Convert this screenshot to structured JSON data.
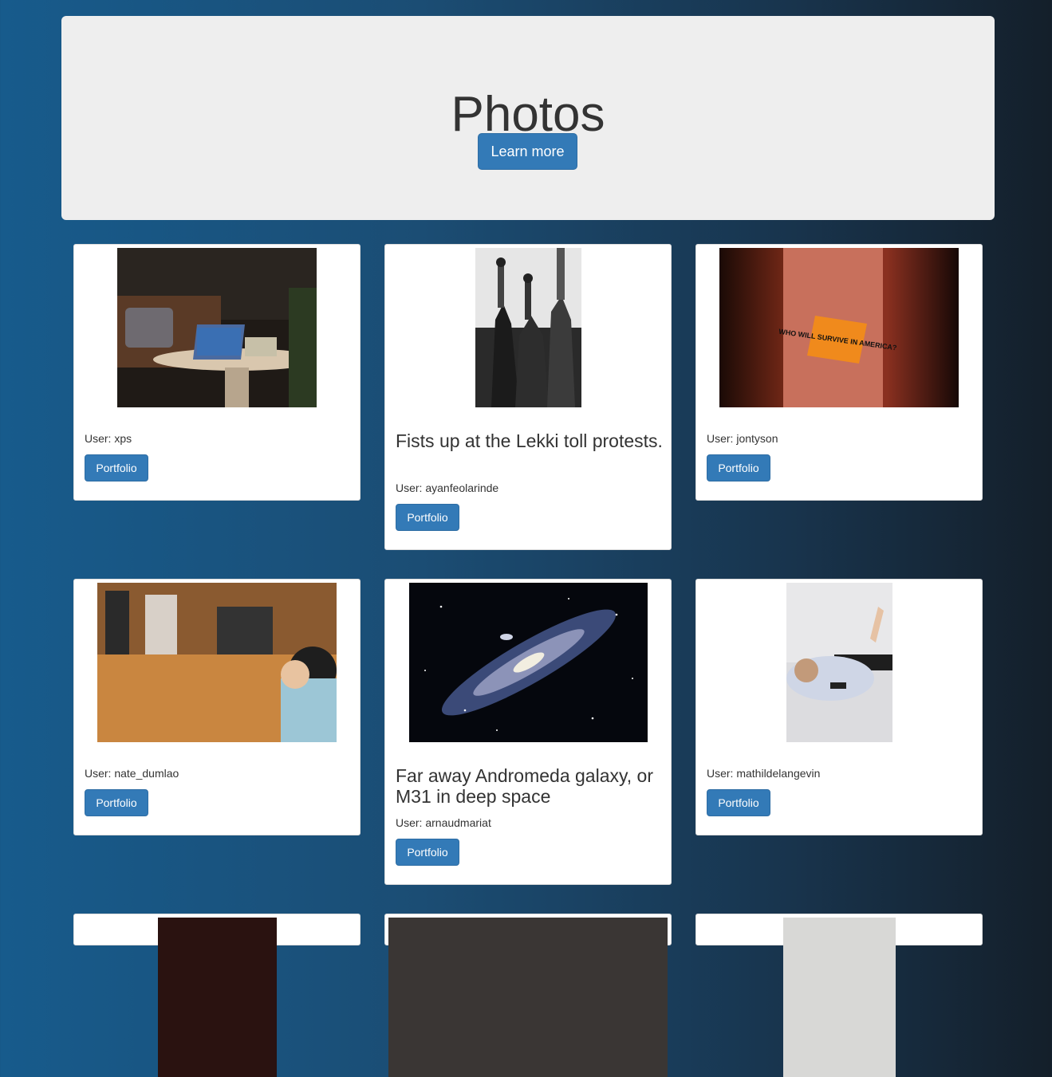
{
  "header": {
    "title": "Photos",
    "learn_more": "Learn more"
  },
  "user_prefix": "User: ",
  "photos": [
    {
      "title": "",
      "user": "User: xps",
      "button": "Portfolio"
    },
    {
      "title": "Fists up at the Lekki toll protests.",
      "user": "User: ayanfeolarinde",
      "button": "Portfolio"
    },
    {
      "title": "",
      "user": "User: jontyson",
      "button": "Portfolio",
      "sticker_text": "WHO WILL SURVIVE IN AMERICA?"
    },
    {
      "title": "",
      "user": "User: nate_dumlao",
      "button": "Portfolio"
    },
    {
      "title": "Far away Andromeda galaxy, or M31 in deep space",
      "user": "User: arnaudmariat",
      "button": "Portfolio"
    },
    {
      "title": "",
      "user": "User: mathildelangevin",
      "button": "Portfolio"
    }
  ]
}
